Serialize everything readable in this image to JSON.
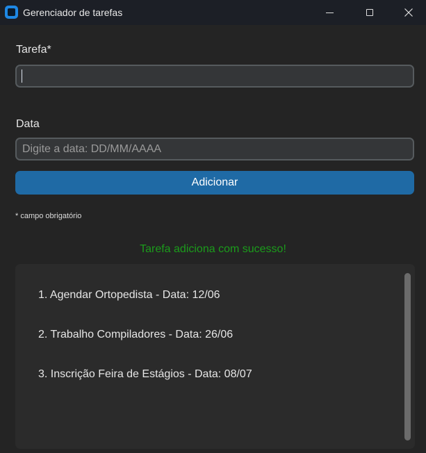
{
  "window": {
    "title": "Gerenciador de tarefas",
    "icon": "app-window-icon",
    "controls": [
      "minimize-icon",
      "maximize-icon",
      "close-icon"
    ]
  },
  "form": {
    "tarefa_label": "Tarefa*",
    "tarefa_value": "",
    "data_label": "Data",
    "data_value": "",
    "data_placeholder": "Digite a data: DD/MM/AAAA",
    "add_button_label": "Adicionar",
    "required_note": "* campo obrigatório"
  },
  "status": {
    "message": "Tarefa adiciona com sucesso!",
    "color": "#1b9c1b"
  },
  "tasks": [
    "1. Agendar Ortopedista - Data: 12/06",
    "2. Trabalho Compiladores - Data: 26/06",
    "3. Inscrição Feira de Estágios - Data: 08/07"
  ],
  "colors": {
    "accent": "#1f6aa5",
    "background": "#242424",
    "titlebar": "#1c1f26"
  }
}
